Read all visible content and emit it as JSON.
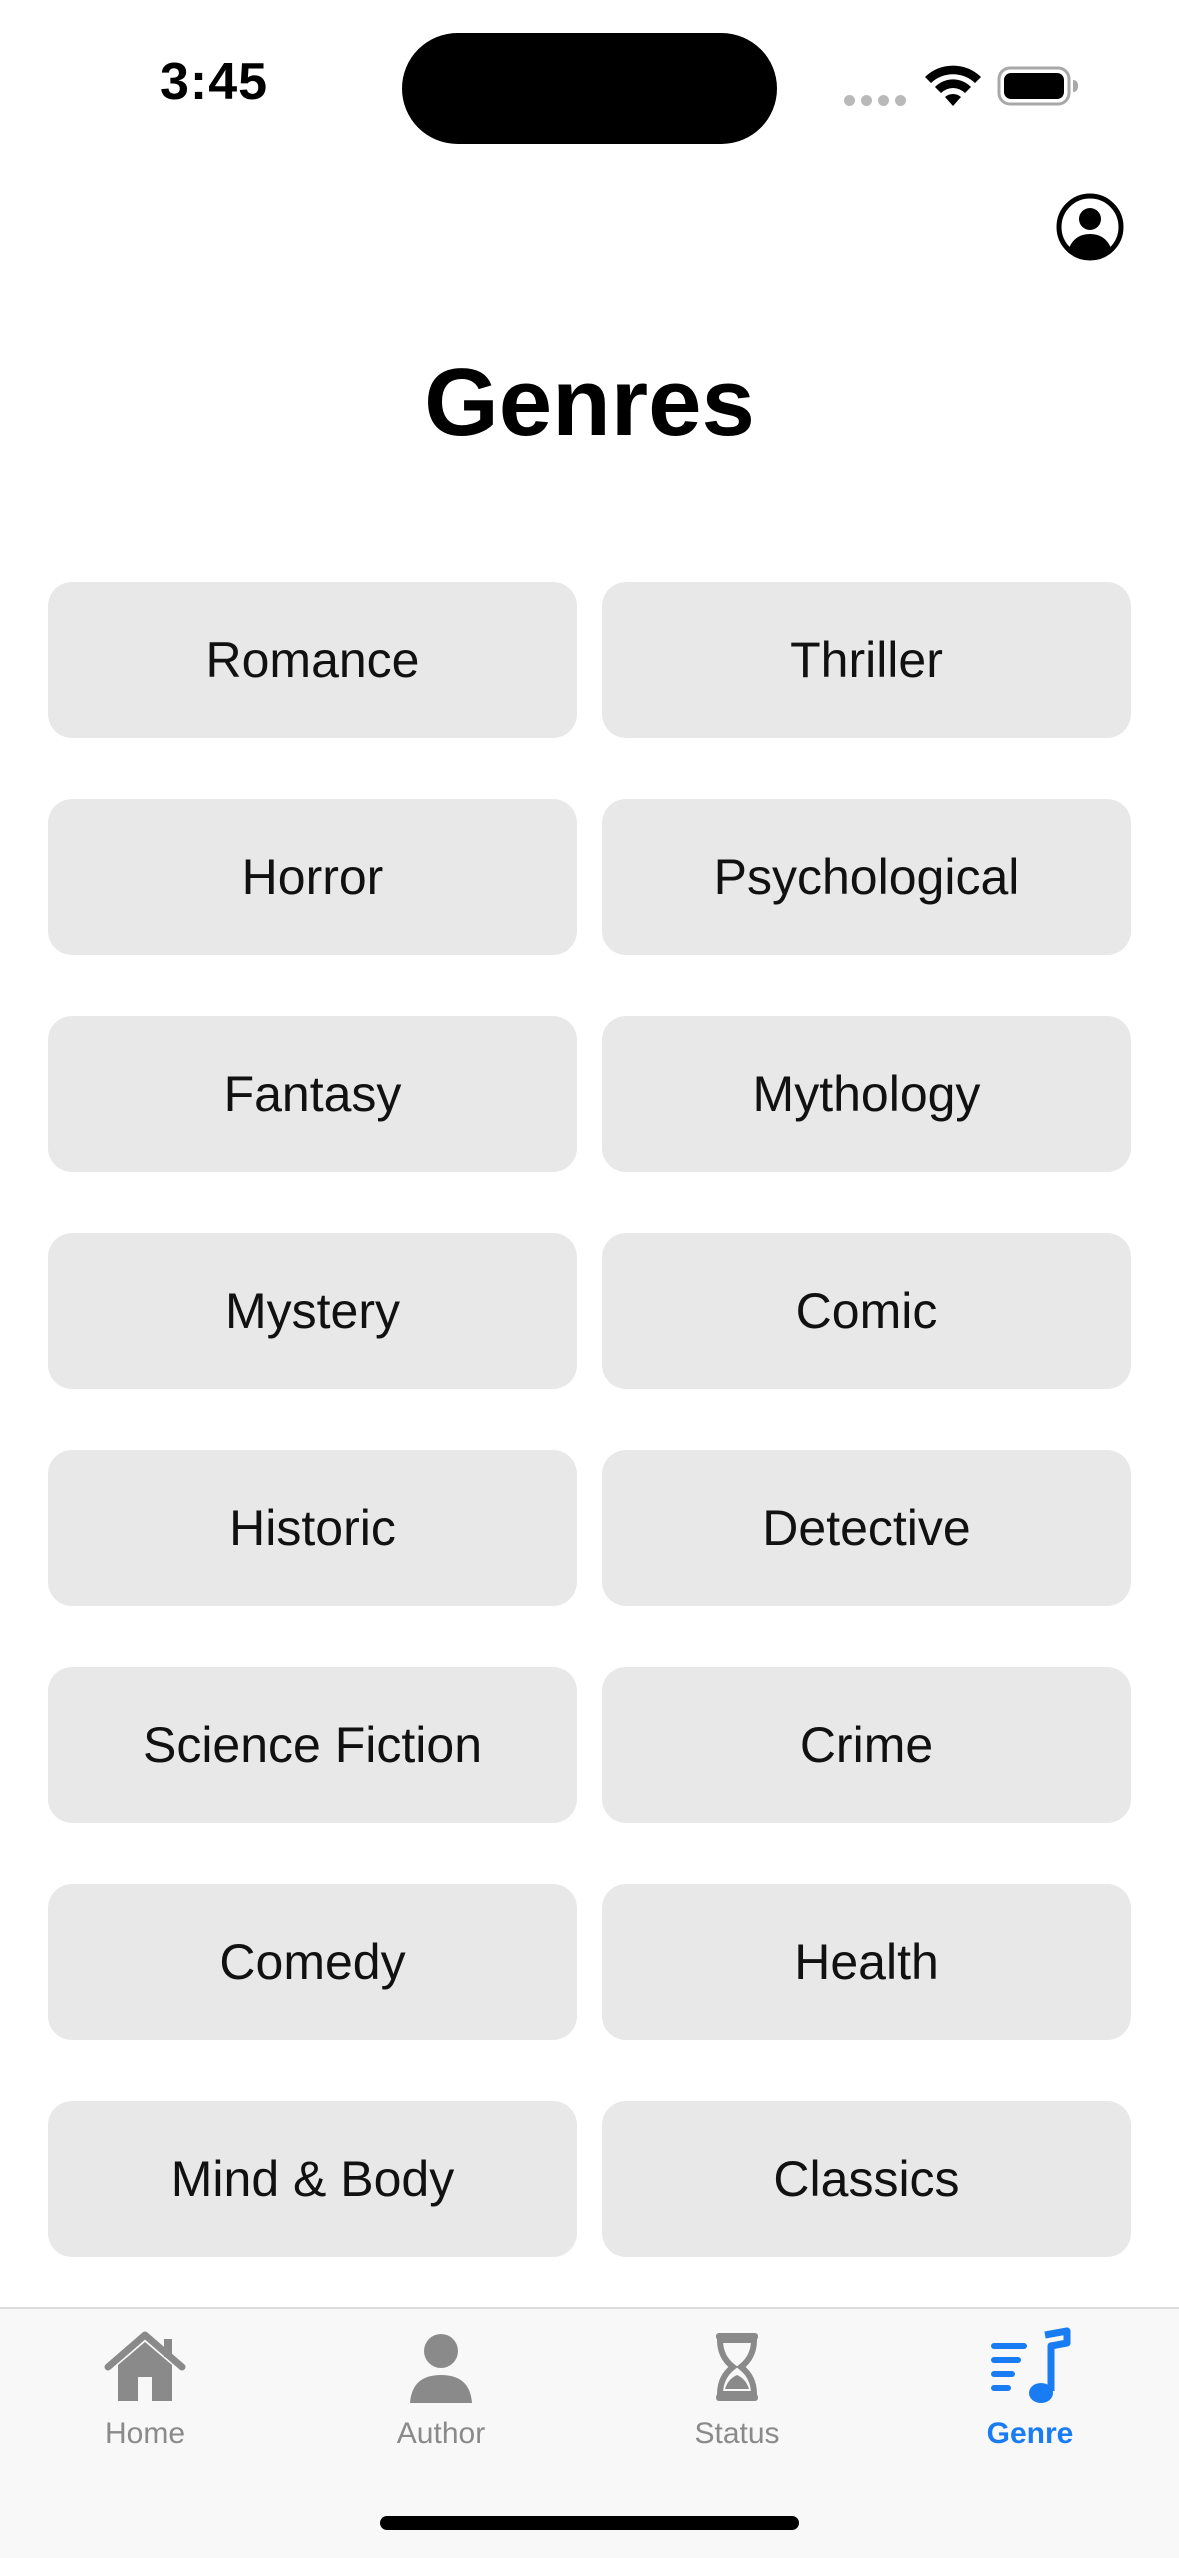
{
  "status_bar": {
    "time": "3:45"
  },
  "header": {
    "profile_icon": "person-circle-icon"
  },
  "title": "Genres",
  "genres": [
    "Romance",
    "Thriller",
    "Horror",
    "Psychological",
    "Fantasy",
    "Mythology",
    "Mystery",
    "Comic",
    "Historic",
    "Detective",
    "Science Fiction",
    "Crime",
    "Comedy",
    "Health",
    "Mind & Body",
    "Classics"
  ],
  "tab_bar": {
    "active": "Genre",
    "accent_color": "#1a7cf2",
    "inactive_color": "#8a8a8a",
    "tabs": [
      {
        "label": "Home",
        "icon": "house-icon"
      },
      {
        "label": "Author",
        "icon": "person-icon"
      },
      {
        "label": "Status",
        "icon": "hourglass-icon"
      },
      {
        "label": "Genre",
        "icon": "music-list-icon"
      }
    ]
  },
  "colors": {
    "background": "#ffffff",
    "genre_button": "#e8e8e8"
  }
}
